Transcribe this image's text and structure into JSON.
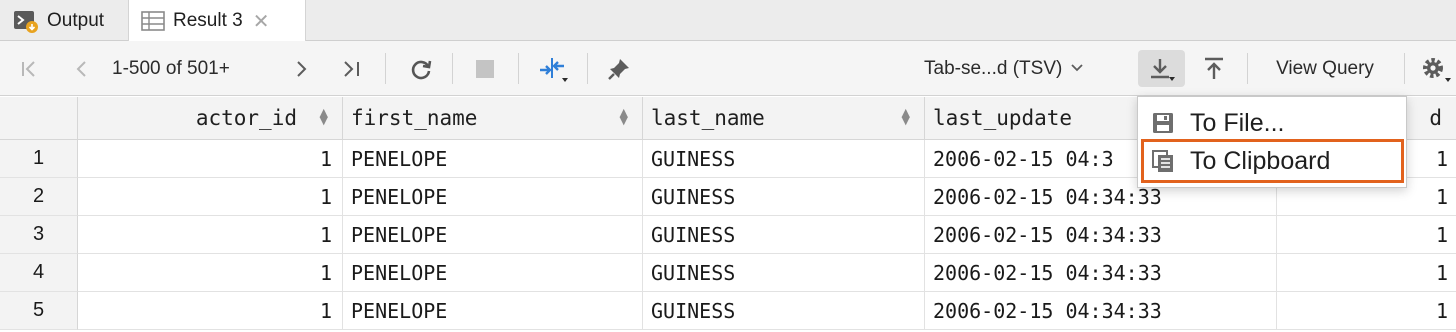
{
  "tabs": [
    {
      "label": "Output",
      "icon": "console-icon"
    },
    {
      "label": "Result 3",
      "icon": "table-icon",
      "close": "✕"
    }
  ],
  "toolbar": {
    "pager": "1-500 of 501+",
    "format": "Tab-se...d (TSV)",
    "view_query": "View Query"
  },
  "grid": {
    "columns": [
      {
        "label": "actor_id"
      },
      {
        "label": "first_name"
      },
      {
        "label": "last_name"
      },
      {
        "label": "last_update"
      },
      {
        "label": "d"
      }
    ],
    "rows": [
      {
        "n": "1",
        "actor_id": "1",
        "first_name": "PENELOPE",
        "last_name": "GUINESS",
        "last_update": "2006-02-15 04:3",
        "extra": "1"
      },
      {
        "n": "2",
        "actor_id": "1",
        "first_name": "PENELOPE",
        "last_name": "GUINESS",
        "last_update": "2006-02-15 04:34:33",
        "extra": "1"
      },
      {
        "n": "3",
        "actor_id": "1",
        "first_name": "PENELOPE",
        "last_name": "GUINESS",
        "last_update": "2006-02-15 04:34:33",
        "extra": "1"
      },
      {
        "n": "4",
        "actor_id": "1",
        "first_name": "PENELOPE",
        "last_name": "GUINESS",
        "last_update": "2006-02-15 04:34:33",
        "extra": "1"
      },
      {
        "n": "5",
        "actor_id": "1",
        "first_name": "PENELOPE",
        "last_name": "GUINESS",
        "last_update": "2006-02-15 04:34:33",
        "extra": "1"
      }
    ]
  },
  "popup": {
    "items": [
      {
        "label": "To File...",
        "icon": "save-icon"
      },
      {
        "label": "To Clipboard",
        "icon": "clipboard-icon",
        "highlight_color": "#e2621d"
      }
    ]
  },
  "colors": {
    "accent": "#e2621d",
    "icon_blue": "#2f7fd8",
    "icon_gray": "#6e6e6e"
  }
}
